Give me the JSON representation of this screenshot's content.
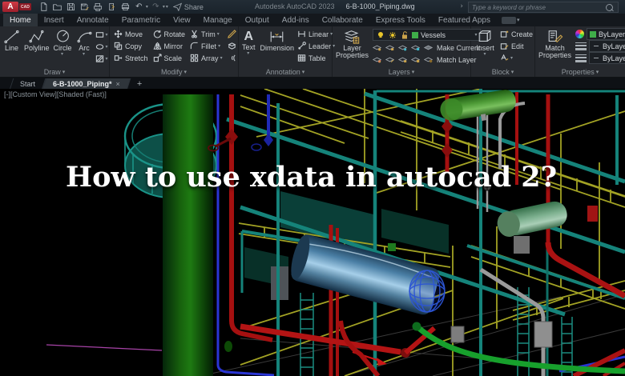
{
  "titlebar": {
    "logo_text": "A",
    "logo_sub": "CAD",
    "share_label": "Share",
    "app_title": "Autodesk AutoCAD 2023",
    "doc_title": "6-B-1000_Piping.dwg",
    "search_placeholder": "Type a keyword or phrase"
  },
  "ribbon_tabs": {
    "active": "Home",
    "items": [
      "Home",
      "Insert",
      "Annotate",
      "Parametric",
      "View",
      "Manage",
      "Output",
      "Add-ins",
      "Collaborate",
      "Express Tools",
      "Featured Apps"
    ]
  },
  "panels": {
    "draw": {
      "label": "Draw",
      "line": "Line",
      "polyline": "Polyline",
      "circle": "Circle",
      "arc": "Arc"
    },
    "modify": {
      "label": "Modify",
      "move": "Move",
      "copy": "Copy",
      "stretch": "Stretch",
      "rotate": "Rotate",
      "mirror": "Mirror",
      "scale": "Scale",
      "trim": "Trim",
      "fillet": "Fillet",
      "array": "Array"
    },
    "annotation": {
      "label": "Annotation",
      "text": "Text",
      "dimension": "Dimension",
      "linear": "Linear",
      "leader": "Leader",
      "table": "Table"
    },
    "layers": {
      "label": "Layers",
      "layer_properties": "Layer Properties",
      "current_layer": "Vessels",
      "make_current": "Make Current",
      "match_layer": "Match Layer"
    },
    "block": {
      "label": "Block",
      "insert": "Insert",
      "create": "Create",
      "edit": "Edit"
    },
    "properties": {
      "label": "Properties",
      "match_properties": "Match Properties",
      "color_value": "ByLayer",
      "lineweight_value": "ByLayer",
      "linetype_value": "ByLayer"
    }
  },
  "file_tabs": {
    "start": "Start",
    "doc": "6-B-1000_Piping*"
  },
  "viewport": {
    "controls": "[-][Custom View][Shaded (Fast)]",
    "overlay_title": "How to use xdata in autocad 2?"
  },
  "glyphs": {
    "dropdown": "▾",
    "close": "×",
    "plus": "+",
    "undo": "↶",
    "redo": "↷",
    "caret": "›"
  },
  "colors": {
    "titlebar_bg": "#1c242c",
    "ribbon_bg": "#26292e",
    "active_tab_bg": "#2d3339",
    "layer_swatch": "#3fae49",
    "logo_red": "#c22033",
    "viewport_bg": "#000000",
    "scaffold_yellow": "#a2a224",
    "structure_teal": "#15837a",
    "pipe_red": "#a51010",
    "pipe_blue": "#2a35d4",
    "pipe_green": "#17a02c",
    "column_green": "#17610d",
    "drum_blue": "#4a7fa5",
    "vessel_green": "#4f9c38"
  },
  "icons": {
    "search": "magnifier",
    "share": "paper-plane",
    "undo": "arrow-undo",
    "redo": "arrow-redo",
    "layer_bulb": "lightbulb",
    "layer_sun": "sun",
    "layer_lock": "unlock",
    "color_wheel": "wheel"
  }
}
